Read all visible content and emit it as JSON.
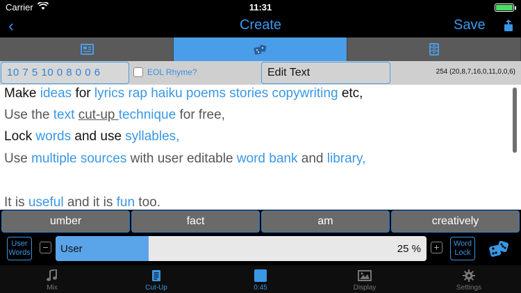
{
  "status": {
    "carrier": "Carrier",
    "time": "11:31"
  },
  "nav": {
    "back": "‹",
    "title": "Create",
    "save": "Save"
  },
  "segments": [
    {
      "icon": "newspaper-icon",
      "active": false
    },
    {
      "icon": "dice-icon",
      "active": true
    },
    {
      "icon": "cabinet-icon",
      "active": false
    }
  ],
  "info": {
    "syllables": "10 7 5 10 0 8 0 0 6",
    "eol_label": "EOL Rhyme?",
    "edit_label": "Edit Text",
    "counts": "254 (20,8,7,16,0,11,0,0,6)"
  },
  "text": {
    "line1": [
      "Make",
      "ideas",
      "for",
      "lyrics",
      "rap",
      "haiku",
      "poems",
      "stories",
      "copywriting",
      "etc,"
    ],
    "line2": [
      "Use",
      "the",
      "text",
      "cut-up",
      "technique",
      "for",
      "free,"
    ],
    "line3": [
      "Lock",
      "words",
      "and",
      "use",
      "syllables,"
    ],
    "line4": [
      "Use",
      "multiple",
      "sources",
      "with",
      "user",
      "editable",
      "word",
      "bank",
      "and",
      "library,"
    ],
    "line5": [
      "It",
      "is",
      "useful",
      "and",
      "it",
      "is",
      "fun",
      "too."
    ]
  },
  "words": [
    "umber",
    "fact",
    "am",
    "creatively"
  ],
  "controls": {
    "user_words_1": "User",
    "user_words_2": "Words",
    "minus": "−",
    "plus": "+",
    "slider_label": "User",
    "slider_value": "25 %",
    "slider_fraction": 0.25,
    "word_lock_1": "Word",
    "word_lock_2": "Lock"
  },
  "tabs": [
    {
      "label": "Mix",
      "icon": "music-note-icon",
      "active": false
    },
    {
      "label": "Cut-Up",
      "icon": "document-icon",
      "active": true
    },
    {
      "label": "0:45",
      "icon": "stop-icon",
      "active": true
    },
    {
      "label": "Display",
      "icon": "image-icon",
      "active": false
    },
    {
      "label": "Settings",
      "icon": "gear-icon",
      "active": false
    }
  ],
  "colors": {
    "accent": "#3a97e4",
    "active_segment": "#4a9de8",
    "battery": "#4cd964"
  }
}
